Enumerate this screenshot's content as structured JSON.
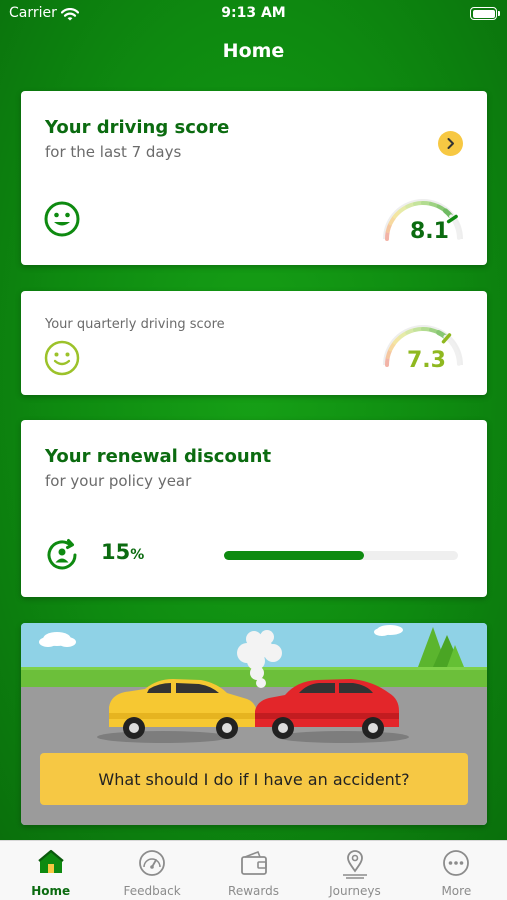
{
  "status_bar": {
    "carrier": "Carrier",
    "time": "9:13 AM"
  },
  "nav": {
    "title": "Home"
  },
  "weekly_score": {
    "title": "Your driving score",
    "subtitle": "for the last 7 days",
    "score": "8.1",
    "score_fraction": 0.81,
    "color": "#0e8a10"
  },
  "quarterly_score": {
    "title": "Your quarterly driving score",
    "score": "7.3",
    "score_fraction": 0.73,
    "color": "#8fb820"
  },
  "renewal": {
    "title": "Your renewal discount",
    "subtitle": "for your policy year",
    "discount_value": "15",
    "discount_unit": "%",
    "progress_fraction": 0.6
  },
  "accident_banner": {
    "cta_label": "What should I do if I have an accident?"
  },
  "tabbar": {
    "items": [
      {
        "label": "Home",
        "icon": "home-icon",
        "active": true
      },
      {
        "label": "Feedback",
        "icon": "speedometer-icon",
        "active": false
      },
      {
        "label": "Rewards",
        "icon": "wallet-icon",
        "active": false
      },
      {
        "label": "Journeys",
        "icon": "location-pin-icon",
        "active": false
      },
      {
        "label": "More",
        "icon": "more-icon",
        "active": false
      }
    ]
  },
  "colors": {
    "brand_green": "#0e8a10",
    "accent_yellow": "#f6c844",
    "title_green": "#0b6b10"
  }
}
